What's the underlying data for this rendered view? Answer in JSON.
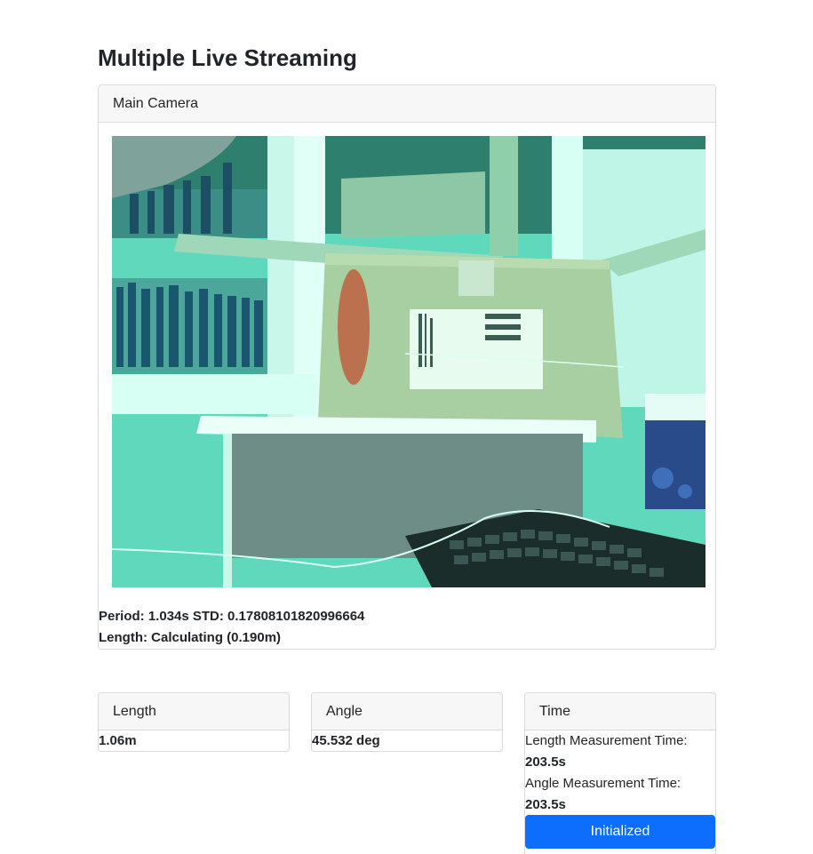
{
  "page": {
    "title": "Multiple Live Streaming"
  },
  "main_camera": {
    "header": "Main Camera",
    "period_line": "Period: 1.034s STD: 0.17808101820996664",
    "length_line": "Length: Calculating (0.190m)"
  },
  "length_card": {
    "header": "Length",
    "value": "1.06m"
  },
  "angle_card": {
    "header": "Angle",
    "value": "45.532 deg"
  },
  "time_card": {
    "header": "Time",
    "length_label": "Length Measurement Time:",
    "length_value": "203.5s",
    "angle_label": "Angle Measurement Time:",
    "angle_value": "203.5s",
    "button_label": "Initialized"
  },
  "colors": {
    "accent": "#0d6efd",
    "camera_tint": "#4fd1b0"
  }
}
